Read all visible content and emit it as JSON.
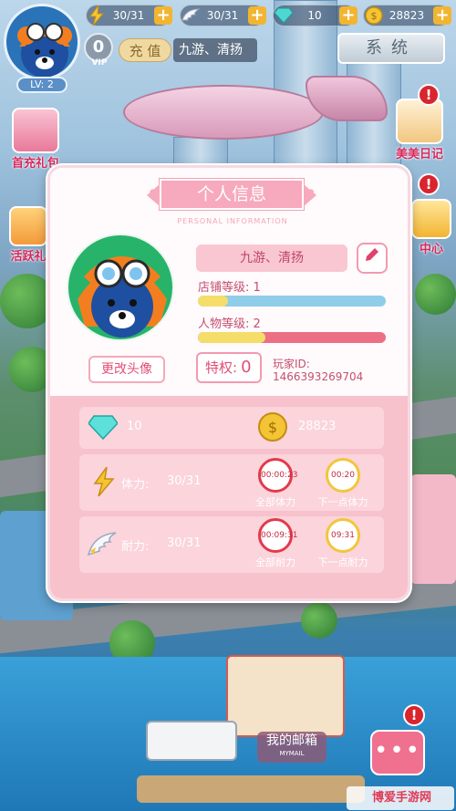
{
  "hud": {
    "level": "LV: 2",
    "vip_level": "0",
    "vip_label": "VIP",
    "recharge_label": "充 值",
    "player_name": "九游、清扬",
    "system_label": "系统",
    "resources": [
      {
        "name": "stamina",
        "icon": "lightning-icon",
        "value": "30/31"
      },
      {
        "name": "endurance",
        "icon": "wing-icon",
        "value": "30/31"
      },
      {
        "name": "diamonds",
        "icon": "diamond-icon",
        "value": "10"
      },
      {
        "name": "coins",
        "icon": "coin-icon",
        "value": "28823"
      }
    ]
  },
  "side": {
    "first_recharge": "首充礼包",
    "activity": "活跃礼",
    "diary": "美美日记",
    "center": "中心"
  },
  "profile": {
    "title": "个人信息",
    "subtitle": "PERSONAL INFORMATION",
    "change_avatar": "更改头像",
    "name": "九游、清扬",
    "shop_level_label": "店铺等级: 1",
    "shop_level_progress": 0.16,
    "char_level_label": "人物等级: 2",
    "char_level_progress": 0.36,
    "privilege_label": "特权:",
    "privilege_value": "0",
    "player_id_label": "玩家ID:",
    "player_id": "1466393269704",
    "diamonds": "10",
    "coins": "28823",
    "stamina_label": "体力:",
    "stamina_value": "30/31",
    "endurance_label": "耐力:",
    "endurance_value": "30/31",
    "timers": {
      "all_stamina_time": "00:00:23",
      "next_stamina_time": "00:20",
      "all_stamina_label": "全部体力",
      "next_stamina_label": "下一点体力",
      "all_endurance_time": "00:09:31",
      "next_endurance_time": "09:31",
      "all_endurance_label": "全部耐力",
      "next_endurance_label": "下一点耐力"
    }
  },
  "bottom": {
    "mailbox": "我的邮箱",
    "mailbox_en": "MYMAIL",
    "watermark": "博爱手游网"
  },
  "colors": {
    "accent_pink": "#f7a9bd",
    "panel_pink": "#f7c2cc",
    "alert_red": "#d9252e",
    "gold": "#f2b531"
  }
}
